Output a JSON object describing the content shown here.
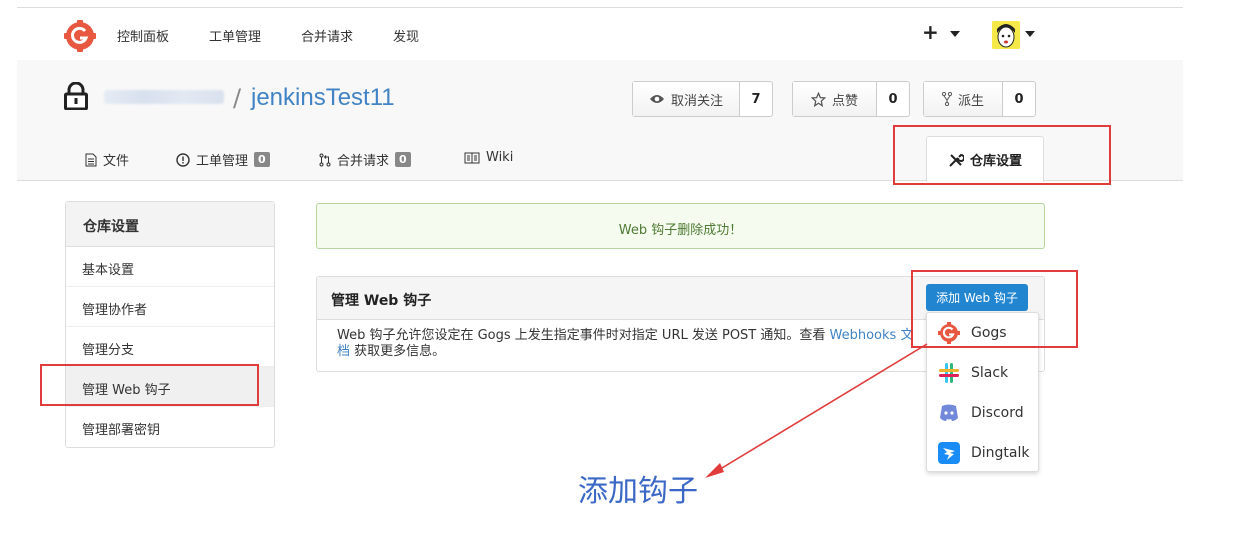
{
  "nav": {
    "items": [
      "控制面板",
      "工单管理",
      "合并请求",
      "发现"
    ],
    "plus": "+",
    "logo_icon": "gogs-logo-icon",
    "avatar_icon": "avatar-icon"
  },
  "repo": {
    "slash": "/",
    "name": "jenkinsTest11",
    "buttons": [
      {
        "label": "取消关注",
        "icon": "eye-icon",
        "count": "7"
      },
      {
        "label": "点赞",
        "icon": "star-icon",
        "count": "0"
      },
      {
        "label": "派生",
        "icon": "fork-icon",
        "count": "0"
      }
    ],
    "tabs": [
      {
        "label": "文件",
        "icon": "file-icon",
        "badge": ""
      },
      {
        "label": "工单管理",
        "icon": "issue-icon",
        "badge": "0"
      },
      {
        "label": "合并请求",
        "icon": "pull-request-icon",
        "badge": "0"
      },
      {
        "label": "Wiki",
        "icon": "book-icon",
        "badge": ""
      }
    ],
    "active_tab": "仓库设置"
  },
  "sidebar": {
    "title": "仓库设置",
    "items": [
      {
        "label": "基本设置"
      },
      {
        "label": "管理协作者"
      },
      {
        "label": "管理分支"
      },
      {
        "label": "管理 Web 钩子"
      },
      {
        "label": "管理部署密钥"
      }
    ],
    "active_index": 3
  },
  "flash": {
    "message": "Web 钩子删除成功！",
    "color": "#4f7a35"
  },
  "webhooks": {
    "title": "管理 Web 钩子",
    "add_button": "添加 Web 钩子",
    "desc_before": "Web 钩子允许您设定在 Gogs 上发生指定事件时对指定 URL 发送 POST 通知。查看 ",
    "desc_link": "Webhooks 文档",
    "desc_after": " 获取更多信息。"
  },
  "dropdown": {
    "items": [
      {
        "label": "Gogs",
        "icon": "gogs-icon"
      },
      {
        "label": "Slack",
        "icon": "slack-icon"
      },
      {
        "label": "Discord",
        "icon": "discord-icon"
      },
      {
        "label": "Dingtalk",
        "icon": "dingtalk-icon"
      }
    ]
  },
  "annotation": {
    "text": "添加钩子",
    "color": "#e03c3c"
  }
}
